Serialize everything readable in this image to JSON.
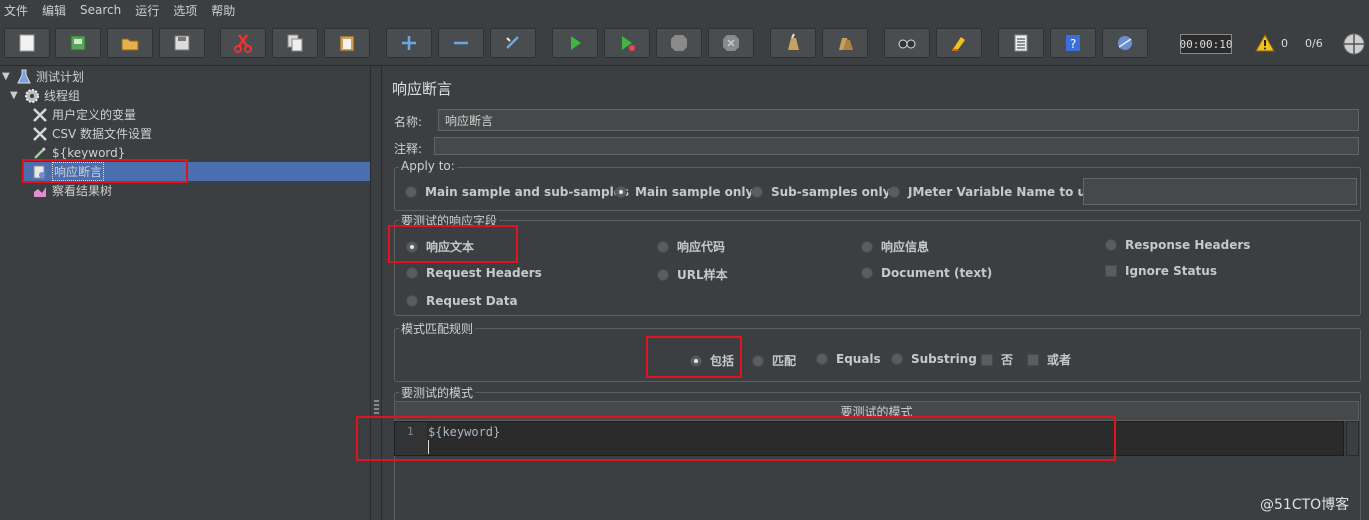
{
  "menu": [
    "文件",
    "编辑",
    "Search",
    "运行",
    "选项",
    "帮助"
  ],
  "toolbar": {
    "icons": [
      "new-icon",
      "templates-icon",
      "open-icon",
      "save-icon",
      "cut-icon",
      "copy-icon",
      "paste-icon",
      "expand-icon",
      "collapse-icon",
      "toggle-icon",
      "start-icon",
      "start-no-pause-icon",
      "stop-icon",
      "shutdown-icon",
      "clear-icon",
      "clear-all-icon",
      "search-icon",
      "reset-search-icon",
      "function-helper-icon",
      "help-icon",
      "remote-icon"
    ],
    "timer": "00:00:10",
    "warning_count": "0",
    "threads": "0/6"
  },
  "tree": [
    {
      "label": "测试计划",
      "icon": "flask-icon",
      "caret": "▼"
    },
    {
      "label": "线程组",
      "icon": "gear-icon",
      "caret": "▼"
    },
    {
      "label": "用户定义的变量",
      "icon": "wrench-icon",
      "caret": ""
    },
    {
      "label": "CSV 数据文件设置",
      "icon": "wrench-icon",
      "caret": ""
    },
    {
      "label": "${keyword}",
      "icon": "pipette-icon",
      "caret": ""
    },
    {
      "label": "响应断言",
      "icon": "assertion-icon",
      "caret": ""
    },
    {
      "label": "察看结果树",
      "icon": "chart-icon",
      "caret": ""
    }
  ],
  "panel": {
    "title": "响应断言",
    "name_label": "名称:",
    "name_value": "响应断言",
    "comment_label": "注释:",
    "comment_value": "",
    "apply_to": {
      "title": "Apply to:",
      "options": [
        "Main sample and sub-samples",
        "Main sample only",
        "Sub-samples only",
        "JMeter Variable Name to use"
      ],
      "selected": 1,
      "variable_value": ""
    },
    "response_field": {
      "title": "要测试的响应字段",
      "options": [
        "响应文本",
        "响应代码",
        "响应信息",
        "Response Headers",
        "Request Headers",
        "URL样本",
        "Document (text)",
        "Request Data"
      ],
      "selected": 0,
      "ignore_status": "Ignore Status"
    },
    "match_rules": {
      "title": "模式匹配规则",
      "options": [
        "包括",
        "匹配",
        "Equals",
        "Substring"
      ],
      "selected": 0,
      "not_label": "否",
      "or_label": "或者"
    },
    "patterns": {
      "title": "要测试的模式",
      "column_header": "要测试的模式",
      "line_number": "1",
      "value": "${keyword}"
    }
  },
  "watermark": "@51CTO博客"
}
